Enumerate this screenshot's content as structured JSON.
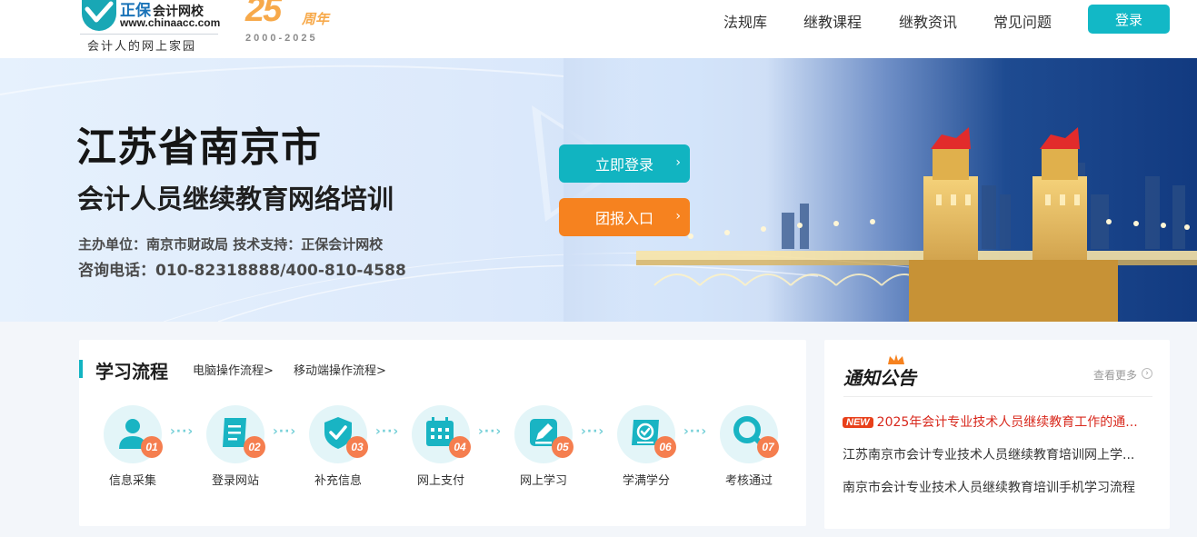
{
  "header": {
    "logo": {
      "brand": "正保",
      "brand_sub": "会计网校",
      "url": "www.chinaacc.com",
      "slogan": "会计人的网上家园"
    },
    "anniversary": {
      "number": "25",
      "word": "周年",
      "years": "2000-2025"
    },
    "nav": [
      {
        "label": "法规库"
      },
      {
        "label": "继教课程"
      },
      {
        "label": "继教资讯"
      },
      {
        "label": "常见问题"
      }
    ],
    "login_label": "登录",
    "accent_color": "#12b8c6"
  },
  "banner": {
    "title": "江苏省南京市",
    "subtitle": "会计人员继续教育网络培训",
    "organizer_line": "主办单位：南京市财政局  技术支持：正保会计网校",
    "phone_line": "咨询电话：010-82318888/400-810-4588",
    "primary_button": "立即登录",
    "secondary_button": "团报入口",
    "button_arrow": "›",
    "primary_color": "#11b4c1",
    "secondary_color": "#f6821f"
  },
  "process": {
    "title": "学习流程",
    "links": [
      {
        "label": "电脑操作流程>"
      },
      {
        "label": "移动端操作流程>"
      }
    ],
    "steps": [
      {
        "number": "01",
        "label": "信息采集",
        "icon": "user-icon"
      },
      {
        "number": "02",
        "label": "登录网站",
        "icon": "document-icon"
      },
      {
        "number": "03",
        "label": "补充信息",
        "icon": "shield-check-icon"
      },
      {
        "number": "04",
        "label": "网上支付",
        "icon": "calendar-icon"
      },
      {
        "number": "05",
        "label": "网上学习",
        "icon": "edit-icon"
      },
      {
        "number": "06",
        "label": "学满学分",
        "icon": "certificate-icon"
      },
      {
        "number": "07",
        "label": "考核通过",
        "icon": "search-icon"
      }
    ],
    "connector": "›··›"
  },
  "notice": {
    "title": "通知公告",
    "more_label": "查看更多",
    "items": [
      {
        "tag": "NEW",
        "text": "2025年会计专业技术人员继续教育工作的通..."
      },
      {
        "tag": "",
        "text": "江苏南京市会计专业技术人员继续教育培训网上学..."
      },
      {
        "tag": "",
        "text": "南京市会计专业技术人员继续教育培训手机学习流程"
      }
    ]
  }
}
